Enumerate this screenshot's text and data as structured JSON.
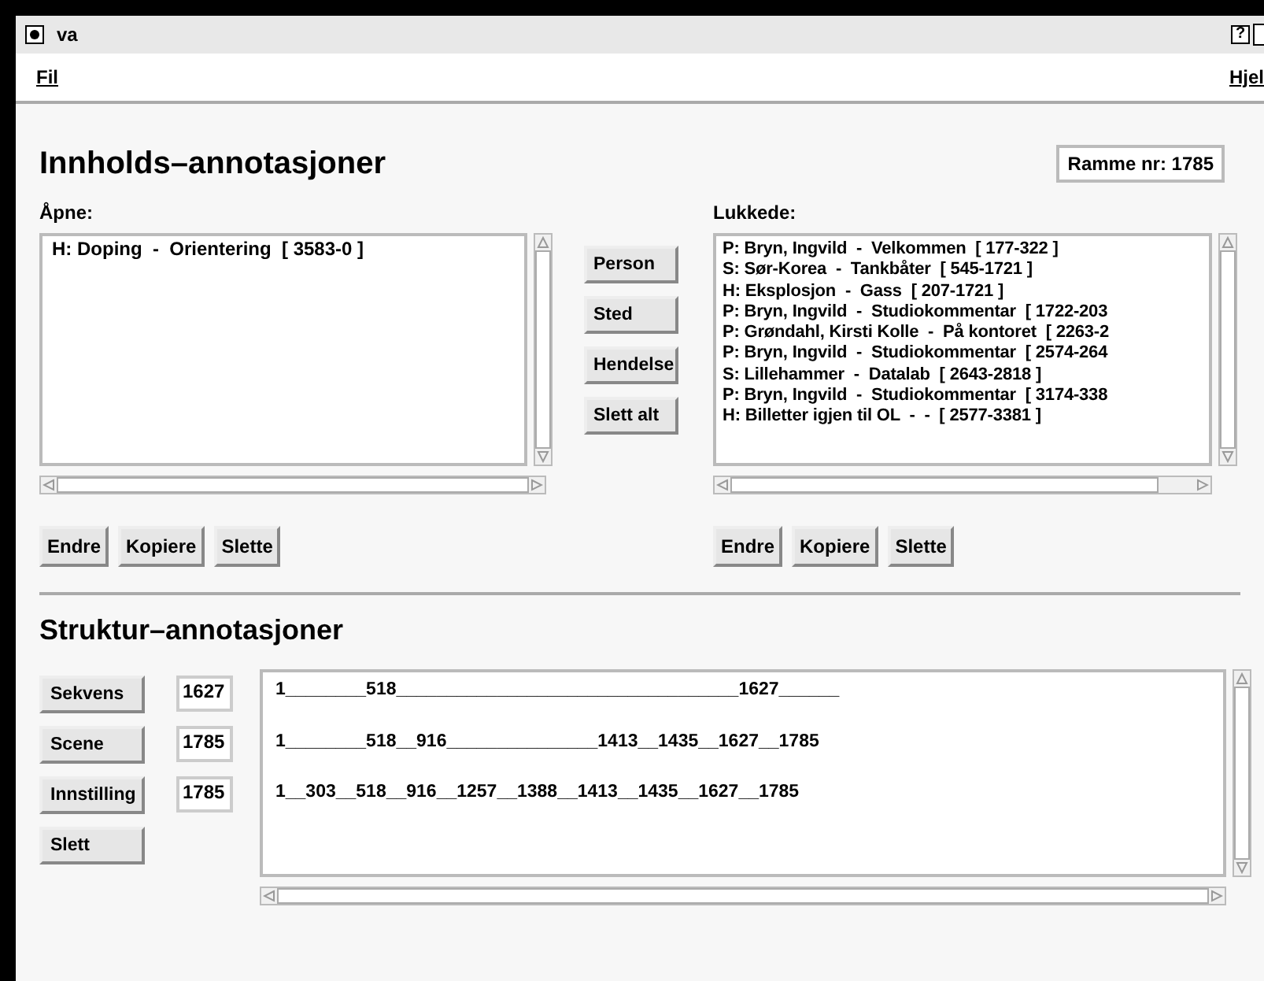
{
  "window": {
    "title": "va",
    "help": "?"
  },
  "menu": [
    "Fil",
    "Hjel"
  ],
  "content": {
    "title": "Innholds–annotasjoner",
    "frame": "Ramme nr: 1785",
    "open": {
      "label": "Åpne:",
      "items": [
        "H: Doping  -  Orientering  [ 3583-0 ]"
      ],
      "buttons": [
        "Endre",
        "Kopiere",
        "Slette"
      ]
    },
    "categories": [
      "Person",
      "Sted",
      "Hendelse",
      "Slett alt"
    ],
    "closed": {
      "label": "Lukkede:",
      "items": [
        "P: Bryn, Ingvild  -  Velkommen  [ 177-322 ]",
        "S: Sør-Korea  -  Tankbåter  [ 545-1721 ]",
        "H: Eksplosjon  -  Gass  [ 207-1721 ]",
        "P: Bryn, Ingvild  -  Studiokommentar  [ 1722-203",
        "P: Grøndahl, Kirsti Kolle  -  På kontoret  [ 2263-2",
        "P: Bryn, Ingvild  -  Studiokommentar  [ 2574-264",
        "S: Lillehammer  -  Datalab  [ 2643-2818 ]",
        "P: Bryn, Ingvild  -  Studiokommentar  [ 3174-338",
        "H: Billetter igjen til OL  -  -  [ 2577-3381 ]"
      ],
      "buttons": [
        "Endre",
        "Kopiere",
        "Slette"
      ]
    }
  },
  "structure": {
    "title": "Struktur–annotasjoner",
    "rows": [
      {
        "button": "Sekvens",
        "value": "1627"
      },
      {
        "button": "Scene",
        "value": "1785"
      },
      {
        "button": "Innstilling",
        "value": "1785"
      }
    ],
    "delete": "Slett",
    "lines": [
      "1________518__________________________________1627______",
      "1________518__916_______________1413__1435__1627__1785",
      "1__303__518__916__1257__1388__1413__1435__1627__1785"
    ]
  }
}
